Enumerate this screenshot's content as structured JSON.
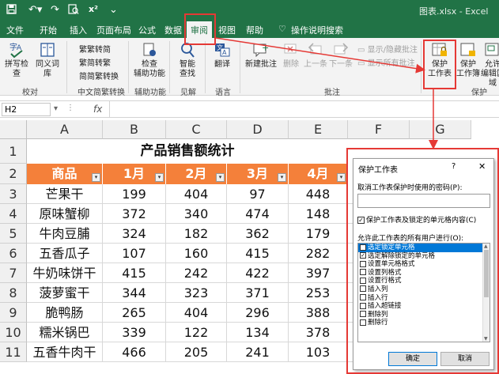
{
  "title_bar": {
    "doc_title": "图表.xlsx - Excel"
  },
  "tabs": [
    {
      "label": "文件"
    },
    {
      "label": "开始"
    },
    {
      "label": "插入"
    },
    {
      "label": "页面布局"
    },
    {
      "label": "公式"
    },
    {
      "label": "数据"
    },
    {
      "label": "审阅"
    },
    {
      "label": "视图"
    },
    {
      "label": "帮助"
    },
    {
      "label": "操作说明搜索"
    }
  ],
  "ribbon": {
    "proofing": {
      "spell": "拼写检查",
      "thesaurus": "同义词库",
      "group": "校对"
    },
    "chinese": {
      "t2s": "繁转简",
      "s2t": "简转繁",
      "convert": "简繁转换",
      "group": "中文简繁转换"
    },
    "accessibility": {
      "check": "检查",
      "check2": "辅助功能",
      "group": "辅助功能"
    },
    "insights": {
      "smart": "智能",
      "smart2": "查找",
      "group": "见解"
    },
    "language": {
      "translate": "翻译",
      "group": "语言"
    },
    "comments": {
      "new": "新建批注",
      "delete": "删除",
      "prev": "上一条",
      "next": "下一条",
      "show_hide": "显示/隐藏批注",
      "show_all": "显示所有批注",
      "group": "批注"
    },
    "protect": {
      "sheet": "保护",
      "sheet2": "工作表",
      "workbook": "保护",
      "workbook2": "工作簿",
      "allow": "允许",
      "allow2": "编辑区域",
      "group": "保护"
    }
  },
  "formula_bar": {
    "name_box": "H2",
    "fx": "fx"
  },
  "columns": [
    "A",
    "B",
    "C",
    "D",
    "E",
    "F",
    "G"
  ],
  "rows": [
    "1",
    "2",
    "3",
    "4",
    "5",
    "6",
    "7",
    "8",
    "9",
    "10",
    "11"
  ],
  "sheet": {
    "title": "产品销售额统计",
    "headers": [
      "商品",
      "1月",
      "2月",
      "3月",
      "4月"
    ],
    "data": [
      [
        "芒果干",
        "199",
        "404",
        "97",
        "448"
      ],
      [
        "原味蟹柳",
        "372",
        "340",
        "474",
        "148"
      ],
      [
        "牛肉豆脯",
        "324",
        "182",
        "362",
        "179"
      ],
      [
        "五香瓜子",
        "107",
        "160",
        "415",
        "282"
      ],
      [
        "牛奶味饼干",
        "415",
        "242",
        "422",
        "397"
      ],
      [
        "菠萝蜜干",
        "344",
        "323",
        "371",
        "253"
      ],
      [
        "脆鸭肠",
        "265",
        "404",
        "296",
        "388"
      ],
      [
        "糯米锅巴",
        "339",
        "122",
        "134",
        "378"
      ],
      [
        "五香牛肉干",
        "466",
        "205",
        "241",
        "103"
      ]
    ]
  },
  "dialog": {
    "title": "保护工作表",
    "help": "?",
    "close": "✕",
    "password_label": "取消工作表保护时使用的密码(P):",
    "protect_checkbox": "保护工作表及锁定的单元格内容(C)",
    "allow_label": "允许此工作表的所有用户进行(O):",
    "permissions": [
      {
        "label": "选定锁定单元格",
        "checked": true,
        "selected": true
      },
      {
        "label": "选定解除锁定的单元格",
        "checked": true,
        "selected": false
      },
      {
        "label": "设置单元格格式",
        "checked": false,
        "selected": false
      },
      {
        "label": "设置列格式",
        "checked": false,
        "selected": false
      },
      {
        "label": "设置行格式",
        "checked": false,
        "selected": false
      },
      {
        "label": "插入列",
        "checked": false,
        "selected": false
      },
      {
        "label": "插入行",
        "checked": false,
        "selected": false
      },
      {
        "label": "插入超链接",
        "checked": false,
        "selected": false
      },
      {
        "label": "删除列",
        "checked": false,
        "selected": false
      },
      {
        "label": "删除行",
        "checked": false,
        "selected": false
      }
    ],
    "ok": "确定",
    "cancel": "取消"
  },
  "colors": {
    "excel_green": "#217346",
    "header_orange": "#f4803a",
    "highlight_red": "#e53935",
    "select_blue": "#0078d7"
  }
}
